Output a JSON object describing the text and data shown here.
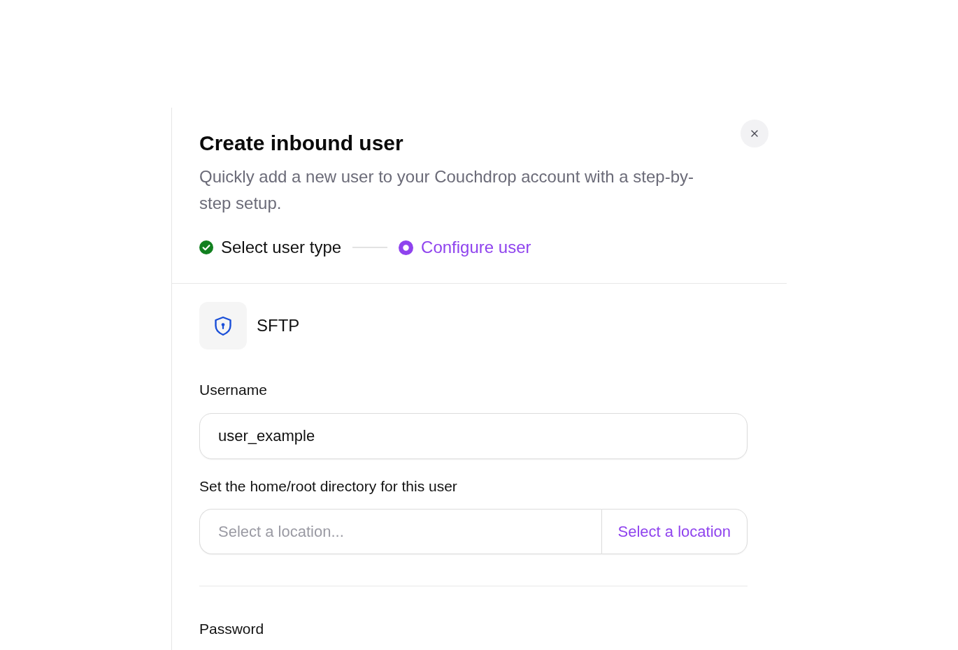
{
  "dialog": {
    "title": "Create inbound user",
    "description": "Quickly add a new user to your Couchdrop account with a step-by-step setup."
  },
  "steps": [
    {
      "label": "Select user type",
      "done": true,
      "selected": false
    },
    {
      "label": "Configure user",
      "done": false,
      "selected": true
    }
  ],
  "user_type": {
    "label": "SFTP"
  },
  "fields": [
    {
      "kind": "text",
      "label": "Username",
      "value": "user_example"
    },
    {
      "kind": "location",
      "label": "Set the home/root directory for this user",
      "placeholder": "Select a location...",
      "button": "Select a location"
    }
  ],
  "next_field": {
    "label": "Password"
  }
}
